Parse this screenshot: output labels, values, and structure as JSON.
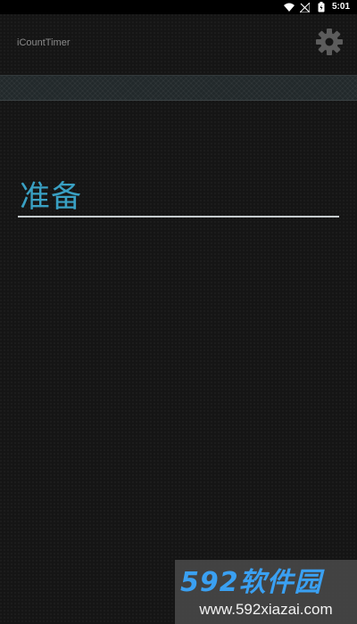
{
  "status_bar": {
    "time": "5:01",
    "icons": [
      "wifi-icon",
      "signal-off-icon",
      "battery-icon"
    ]
  },
  "action_bar": {
    "title": "iCountTimer",
    "settings_icon": "gear-icon"
  },
  "timer": {
    "label": "准备",
    "accent_color": "#39a0c3",
    "underline_color": "#c6ccce"
  },
  "watermark": {
    "logo_text": "592软件园",
    "url": "www.592xiazai.com",
    "logo_color": "#3aa0f2"
  }
}
